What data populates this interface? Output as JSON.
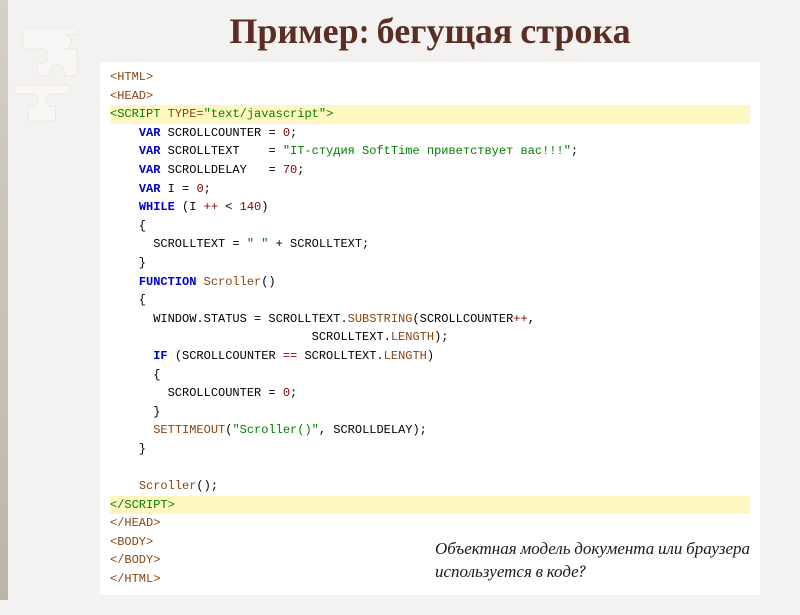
{
  "title": "Пример: бегущая строка",
  "code": {
    "lines": [
      {
        "cls": "tag-brown",
        "text": "<HTML>"
      },
      {
        "cls": "tag-brown",
        "text": "<HEAD>"
      },
      {
        "cls": "hl",
        "html": "<span class='green-tag'>&lt;SCRIPT</span> <span class='attr'>TYPE=</span><span class='str'>\"text/javascript\"</span><span class='green-tag'>&gt;</span>"
      },
      {
        "cls": "",
        "html": "    <span class='kw'>VAR</span> SCROLLCOUNTER = <span class='num'>0</span>;"
      },
      {
        "cls": "",
        "html": "    <span class='kw'>VAR</span> SCROLLTEXT    = <span class='str'>\"IT-студия SoftTime приветствует вас!!!\"</span>;"
      },
      {
        "cls": "",
        "html": "    <span class='kw'>VAR</span> SCROLLDELAY   = <span class='num'>70</span>;"
      },
      {
        "cls": "",
        "html": "    <span class='kw'>VAR</span> I = <span class='num'>0</span>;"
      },
      {
        "cls": "",
        "html": "    <span class='kw'>WHILE</span> (I <span class='op'>++</span> &lt; <span class='num'>140</span>)"
      },
      {
        "cls": "",
        "text": "    {"
      },
      {
        "cls": "",
        "html": "      SCROLLTEXT = <span class='str'>\" \"</span> + SCROLLTEXT;"
      },
      {
        "cls": "",
        "text": "    }"
      },
      {
        "cls": "",
        "html": "    <span class='kw'>FUNCTION</span> <span class='fn'>Scroller</span>()"
      },
      {
        "cls": "",
        "text": "    {"
      },
      {
        "cls": "",
        "html": "      WINDOW.STATUS = SCROLLTEXT.<span class='fn'>SUBSTRING</span>(SCROLLCOUNTER<span class='op'>++</span>,"
      },
      {
        "cls": "",
        "html": "                            SCROLLTEXT.<span class='fn'>LENGTH</span>);"
      },
      {
        "cls": "",
        "html": "      <span class='kw'>IF</span> (SCROLLCOUNTER <span class='op'>==</span> SCROLLTEXT.<span class='fn'>LENGTH</span>)"
      },
      {
        "cls": "",
        "text": "      {"
      },
      {
        "cls": "",
        "html": "        SCROLLCOUNTER = <span class='num'>0</span>;"
      },
      {
        "cls": "",
        "text": "      }"
      },
      {
        "cls": "",
        "html": "      <span class='fn'>SETTIMEOUT</span>(<span class='str'>\"Scroller()\"</span>, SCROLLDELAY);"
      },
      {
        "cls": "",
        "text": "    }"
      },
      {
        "cls": "",
        "text": " "
      },
      {
        "cls": "",
        "html": "    <span class='fn'>Scroller</span>();"
      },
      {
        "cls": "hl",
        "html": "<span class='green-tag'>&lt;/SCRIPT&gt;</span>"
      },
      {
        "cls": "tag-brown",
        "text": "</HEAD>"
      },
      {
        "cls": "tag-brown",
        "text": "<BODY>"
      },
      {
        "cls": "tag-brown",
        "text": "</BODY>"
      },
      {
        "cls": "tag-brown",
        "text": "</HTML>"
      }
    ]
  },
  "question_line1": "Объектная модель документа или браузера",
  "question_line2": "используется в коде?"
}
